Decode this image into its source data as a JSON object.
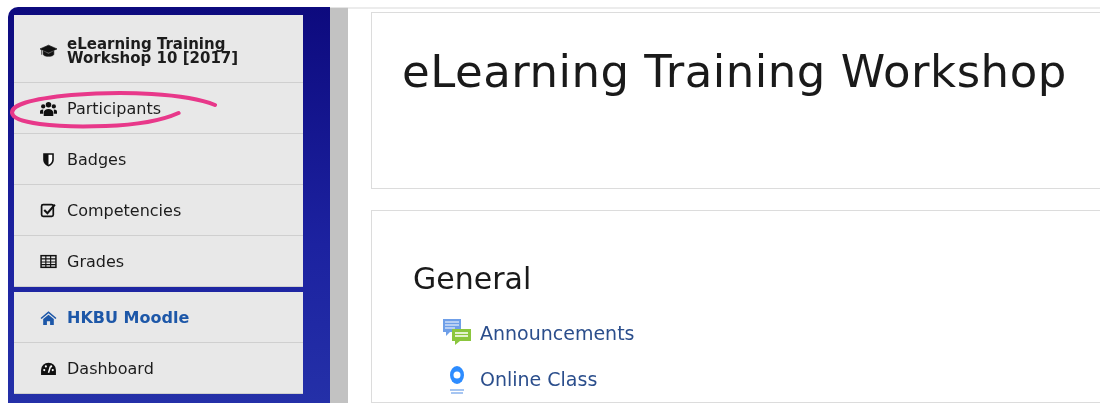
{
  "sidebar": {
    "groups": [
      {
        "items": [
          {
            "kind": "course",
            "label": "eLearning Training Workshop 10 [2017]",
            "circled": false
          },
          {
            "kind": "link",
            "label": "Participants",
            "circled": true
          },
          {
            "kind": "link",
            "label": "Badges",
            "circled": false
          },
          {
            "kind": "link",
            "label": "Competencies",
            "circled": false
          },
          {
            "kind": "link",
            "label": "Grades",
            "circled": false
          }
        ]
      },
      {
        "items": [
          {
            "kind": "site",
            "label": "HKBU Moodle",
            "circled": false
          },
          {
            "kind": "link",
            "label": "Dashboard",
            "circled": false
          }
        ]
      }
    ]
  },
  "page_header": {
    "title": "eLearning Training Workshop"
  },
  "section": {
    "title": "General",
    "activities": [
      {
        "label": "Announcements"
      },
      {
        "label": "Online Class"
      }
    ]
  }
}
